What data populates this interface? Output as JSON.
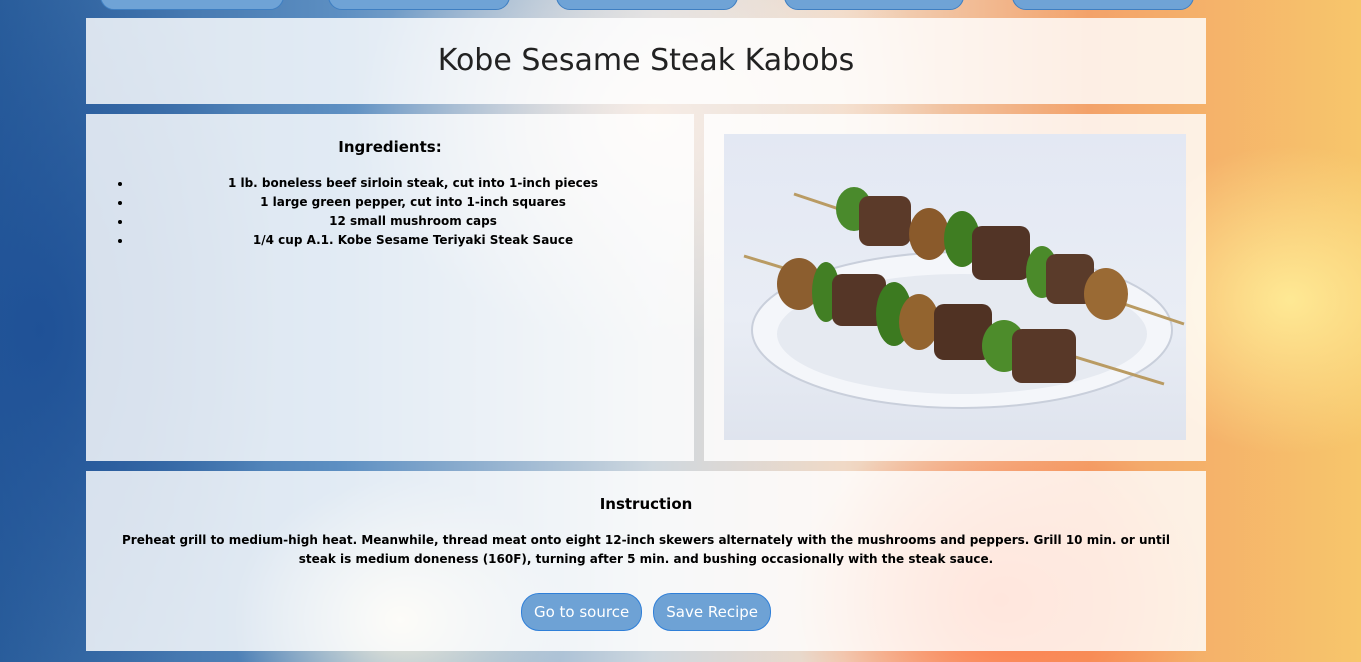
{
  "recipe": {
    "title": "Kobe Sesame Steak Kabobs",
    "ingredients_heading": "Ingredients:",
    "ingredients": [
      "1 lb. boneless beef sirloin steak, cut into 1-inch pieces",
      "1 large green pepper, cut into 1-inch squares",
      "12 small mushroom caps",
      "1/4 cup A.1. Kobe Sesame Teriyaki Steak Sauce"
    ],
    "instruction_heading": "Instruction",
    "instruction_text": "Preheat grill to medium-high heat. Meanwhile, thread meat onto eight 12-inch skewers alternately with the mushrooms and peppers. Grill 10 min. or until steak is medium doneness (160F), turning after 5 min. and bushing occasionally with the steak sauce."
  },
  "actions": {
    "source_label": "Go to source",
    "save_label": "Save Recipe"
  },
  "colors": {
    "button_bg": "#6ea2d5",
    "button_border": "#2f7fd8",
    "panel_bg": "rgba(255,255,255,0.82)"
  }
}
